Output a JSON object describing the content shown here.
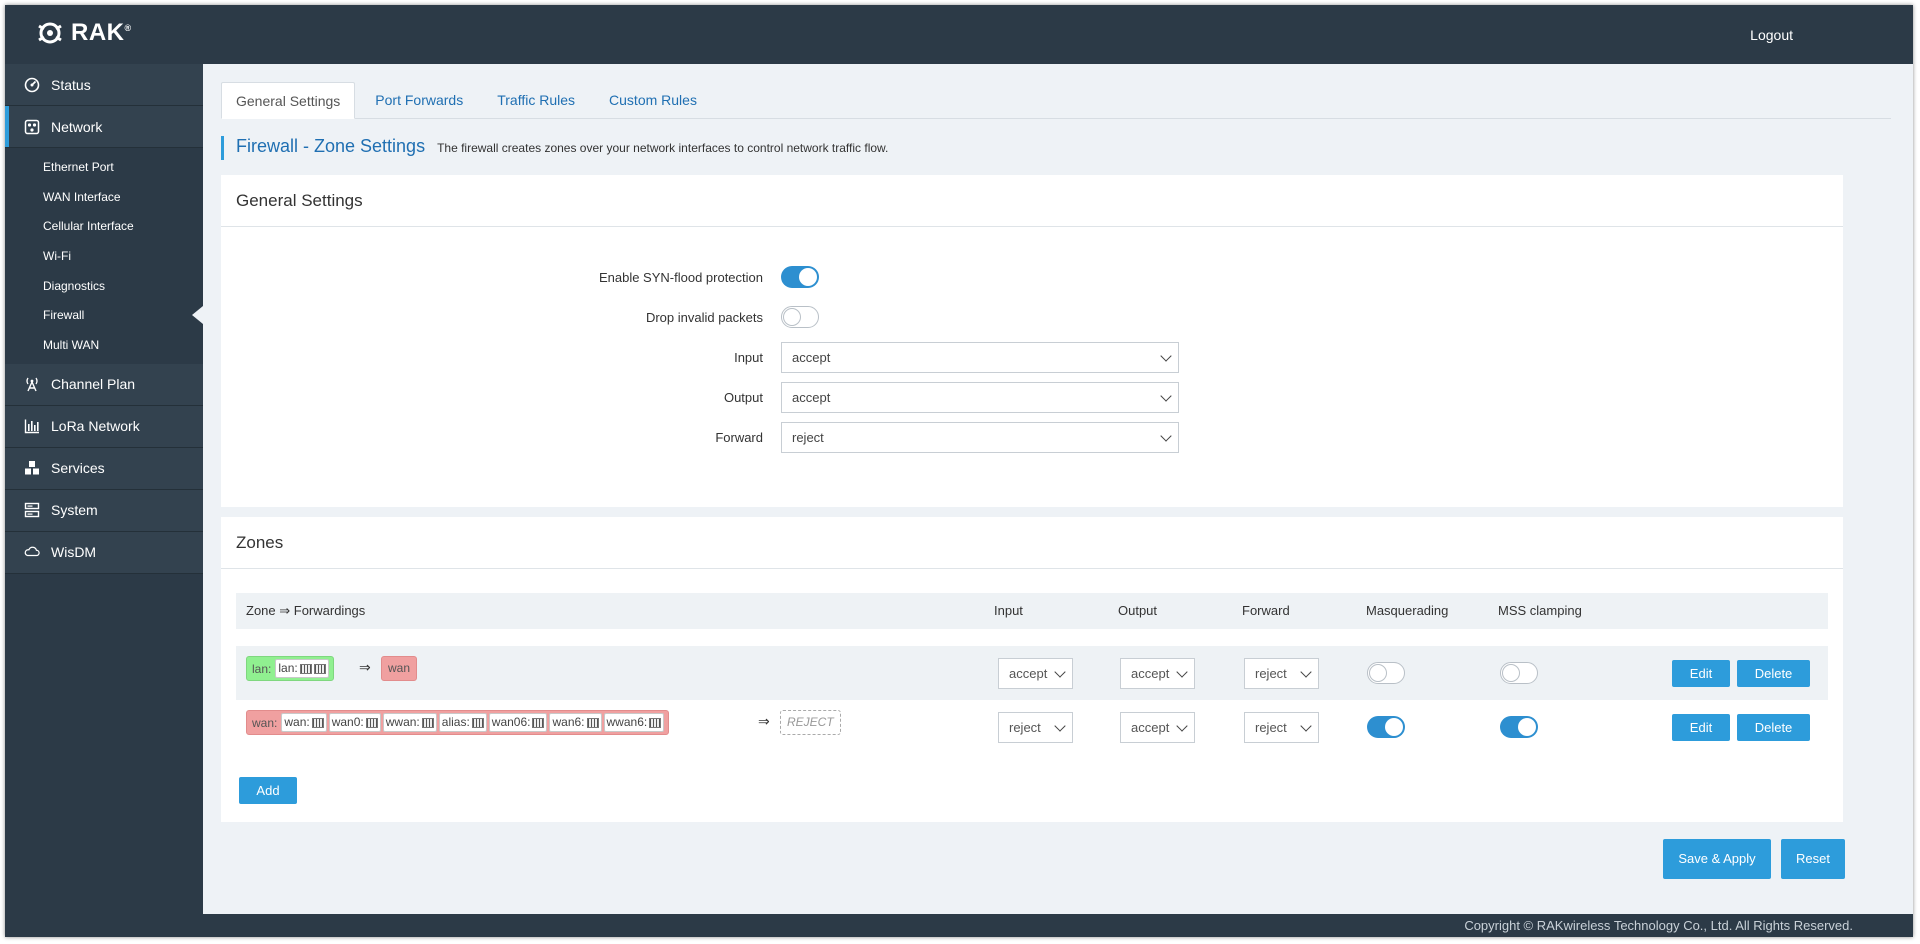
{
  "brand": {
    "name": "RAK",
    "mark": "®"
  },
  "header": {
    "logout_label": "Logout"
  },
  "sidebar": {
    "items": [
      {
        "label": "Status",
        "icon": "gauge-icon"
      },
      {
        "label": "Network",
        "icon": "network-icon"
      },
      {
        "label": "Channel Plan",
        "icon": "antenna-icon"
      },
      {
        "label": "LoRa Network",
        "icon": "bar-chart-icon"
      },
      {
        "label": "Services",
        "icon": "cubes-icon"
      },
      {
        "label": "System",
        "icon": "server-icon"
      },
      {
        "label": "WisDM",
        "icon": "cloud-icon"
      }
    ],
    "network_sub": [
      "Ethernet Port",
      "WAN Interface",
      "Cellular Interface",
      "Wi-Fi",
      "Diagnostics",
      "Firewall",
      "Multi WAN"
    ]
  },
  "tabs": [
    "General Settings",
    "Port Forwards",
    "Traffic Rules",
    "Custom Rules"
  ],
  "page": {
    "title": "Firewall - Zone Settings",
    "description": "The firewall creates zones over your network interfaces to control network traffic flow."
  },
  "general": {
    "heading": "General Settings",
    "syn_label": "Enable SYN-flood protection",
    "syn_enabled": true,
    "drop_label": "Drop invalid packets",
    "drop_enabled": false,
    "input_label": "Input",
    "input_value": "accept",
    "output_label": "Output",
    "output_value": "accept",
    "forward_label": "Forward",
    "forward_value": "reject"
  },
  "zones": {
    "heading": "Zones",
    "columns": {
      "zone": "Zone ⇒ Forwardings",
      "input": "Input",
      "output": "Output",
      "forward": "Forward",
      "masq": "Masquerading",
      "mss": "MSS clamping"
    },
    "arrow": "⇒",
    "rows": [
      {
        "name": "lan:",
        "interfaces": [
          "lan:"
        ],
        "target": "wan",
        "input": "accept",
        "output": "accept",
        "forward": "reject",
        "masquerading": false,
        "mss_clamping": false
      },
      {
        "name": "wan:",
        "interfaces": [
          "wan:",
          "wan0:",
          "wwan:",
          "alias:",
          "wan06:",
          "wan6:",
          "wwan6:"
        ],
        "target": "REJECT",
        "input": "reject",
        "output": "accept",
        "forward": "reject",
        "masquerading": true,
        "mss_clamping": true
      }
    ],
    "edit_label": "Edit",
    "delete_label": "Delete",
    "add_label": "Add"
  },
  "actions": {
    "save_label": "Save & Apply",
    "reset_label": "Reset"
  },
  "footer": {
    "copyright": "Copyright © RAKwireless Technology Co., Ltd. All Rights Reserved."
  },
  "colors": {
    "nav_bg": "#2c3a47",
    "accent": "#2d9cdb",
    "zone_lan": "#90f090",
    "zone_wan": "#f0a0a0"
  }
}
